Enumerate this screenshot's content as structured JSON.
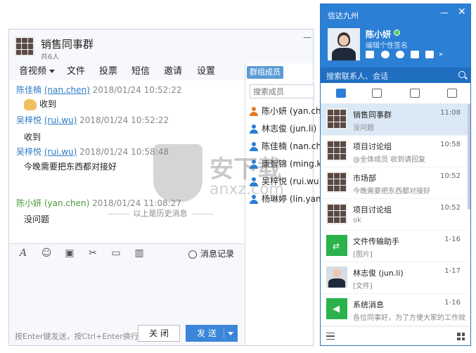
{
  "chat": {
    "title": "销售同事群",
    "member_count": "共6人",
    "menu": [
      "音视频",
      "文件",
      "投票",
      "短信",
      "邀请",
      "设置"
    ],
    "messages": [
      {
        "name": "陈佳楠",
        "account": "(nan.chen)",
        "time": "2018/01/24 10:52:22",
        "body": "收到",
        "emoji": "ok-hand-emoji"
      },
      {
        "name": "吴梓悦",
        "account": "(rui.wu)",
        "time": "2018/01/24 10:52:22",
        "body": "收到"
      },
      {
        "name": "吴梓悦",
        "account": "(rui.wu)",
        "time": "2018/01/24 10:58:48",
        "body": "今晚需要把东西都对接好"
      },
      {
        "name": "陈小妍",
        "account": "(yan.chen)",
        "time": "2018/01/24 11:08:27",
        "body": "没问题"
      }
    ],
    "history_separator": "以上是历史消息",
    "history_button": "消息记录",
    "hint": "按Enter键发送，按Ctrl+Enter换行",
    "close_label": "关 闭",
    "send_label": "发 送"
  },
  "members": {
    "tab": "群组成员",
    "search_placeholder": "搜索成员",
    "list": [
      {
        "name": "陈小妍 (yan.chen)",
        "color": "#e07b2a"
      },
      {
        "name": "林志俊 (jun.li)",
        "color": "#2b7fd4"
      },
      {
        "name": "陈佳楠 (nan.chen)",
        "color": "#2b7fd4"
      },
      {
        "name": "康智锦 (ming.kang)",
        "color": "#2b7fd4"
      },
      {
        "name": "吴梓悦 (rui.wu)",
        "color": "#2b7fd4"
      },
      {
        "name": "杨琳婷 (lin.yang)",
        "color": "#2b7fd4"
      }
    ]
  },
  "watermark": {
    "text": "安下载",
    "sub": "anxz.com"
  },
  "main": {
    "app_title": "信达九州",
    "user_name": "陈小妍",
    "signature": "编辑个性签名",
    "search_placeholder": "搜索联系人、会话",
    "conversations": [
      {
        "name": "销售同事群",
        "sub": "没问题",
        "time": "11:08",
        "avatar": "group",
        "selected": true
      },
      {
        "name": "项目讨论组",
        "sub": "@全体成员 收到请回复",
        "time": "10:58",
        "avatar": "group"
      },
      {
        "name": "市场部",
        "sub": "今晚需要把东西都对接好",
        "time": "10:52",
        "avatar": "group"
      },
      {
        "name": "项目讨论组",
        "sub": "ok",
        "time": "10:52",
        "avatar": "group"
      },
      {
        "name": "文件传输助手",
        "sub": "[图片]",
        "time": "1-16",
        "avatar": "green"
      },
      {
        "name": "林志俊 (jun.li)",
        "sub": "[文件]",
        "time": "1-17",
        "avatar": "photo"
      },
      {
        "name": "系统消息",
        "sub": "各位同事好，为了方便大家的工作效...",
        "time": "1-16",
        "avatar": "green"
      }
    ]
  }
}
